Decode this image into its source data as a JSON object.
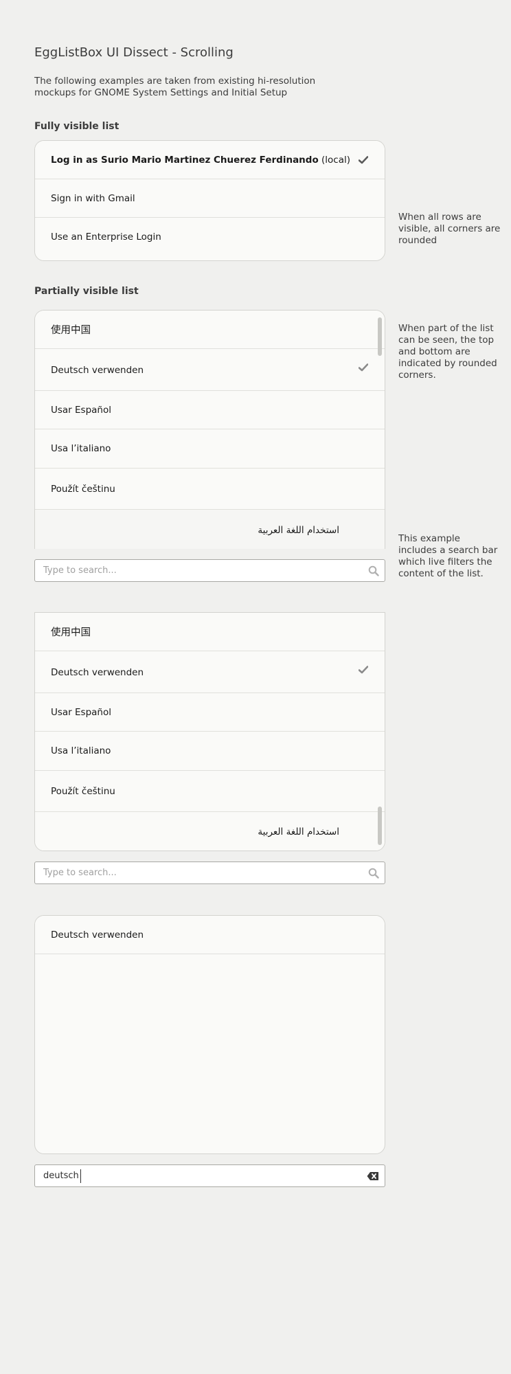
{
  "page": {
    "title": "EggListBox UI Dissect - Scrolling",
    "intro": "The following examples are taken from existing hi-resolution mockups for GNOME System Settings and Initial Setup"
  },
  "sections": {
    "fully_visible": {
      "heading": "Fully visible list",
      "note": "When all rows are visible, all corners are rounded",
      "rows": [
        {
          "bold": "Log in as Surio Mario Martinez Chuerez Ferdinando",
          "suffix": " (local)",
          "checked": true
        },
        {
          "label": "Sign in with Gmail"
        },
        {
          "label": "Use an Enterprise Login"
        }
      ]
    },
    "partially_visible": {
      "heading": "Partially visible list",
      "note": "When part of the list can be seen, the top and bottom are indicated by rounded corners.",
      "search_note": "This example includes a search bar which live filters the content of the list."
    },
    "languages": [
      "使用中国",
      "Deutsch verwenden",
      "Usar Español",
      "Usa l’italiano",
      "Použít češtinu",
      "استخدام اللغة العربية"
    ],
    "search": {
      "placeholder": "Type to search...",
      "filtered_value": "deutsch"
    },
    "filtered_result": "Deutsch verwenden"
  },
  "colors": {
    "background": "#f0f0ee",
    "list_background": "#fafaf8",
    "border": "#d3d3cf",
    "check": "#6e6e6e",
    "scrollbar": "#c8c8c4"
  },
  "icons": {
    "check": "check-icon",
    "search": "search-icon",
    "clear": "clear-text-icon"
  }
}
